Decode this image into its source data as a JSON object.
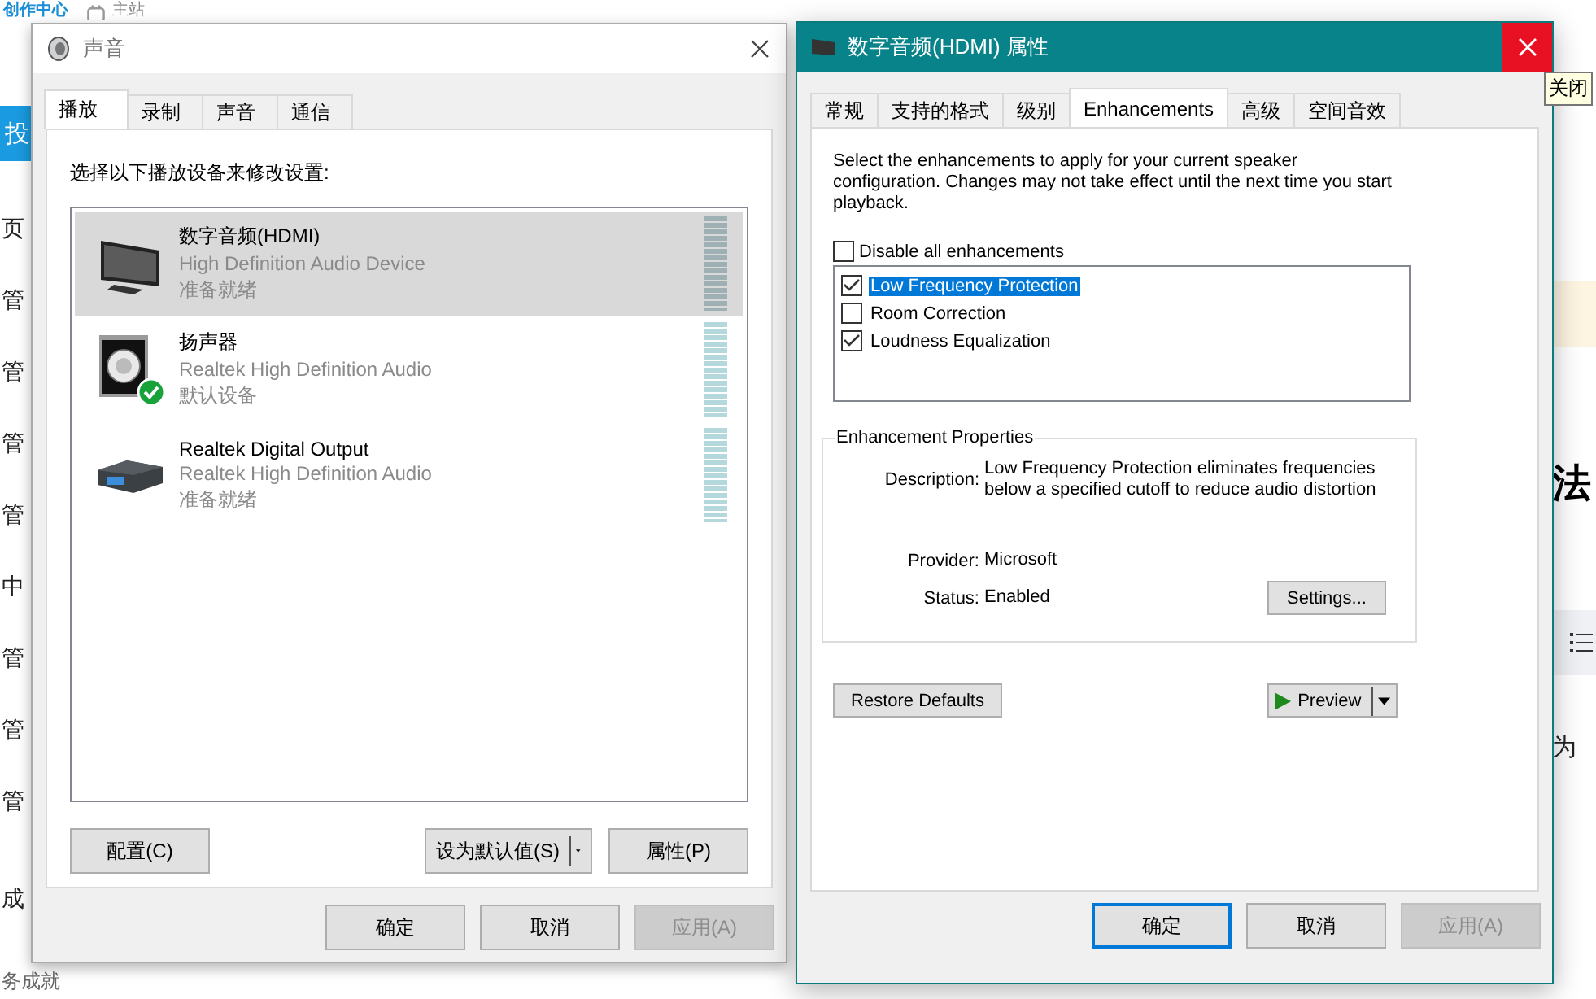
{
  "background_page": {
    "logo": "创作中心",
    "nav_link": "主站",
    "post_button": "投",
    "sidebar_items": [
      "页",
      "管",
      "管",
      "管",
      "管",
      "中",
      "管",
      "管",
      "管",
      "成"
    ],
    "footer_text": "务成就",
    "heading": "法",
    "snippet": "为"
  },
  "sound_dialog": {
    "title": "声音",
    "tabs": [
      {
        "label": "播放",
        "selected": true
      },
      {
        "label": "录制",
        "selected": false
      },
      {
        "label": "声音",
        "selected": false
      },
      {
        "label": "通信",
        "selected": false
      }
    ],
    "instruction": "选择以下播放设备来修改设置:",
    "devices": [
      {
        "kind": "monitor",
        "name": "数字音频(HDMI)",
        "driver": "High Definition Audio Device",
        "status": "准备就绪",
        "selected": true,
        "default": false
      },
      {
        "kind": "speaker",
        "name": "扬声器",
        "driver": "Realtek High Definition Audio",
        "status": "默认设备",
        "selected": false,
        "default": true
      },
      {
        "kind": "receiver",
        "name": "Realtek Digital Output",
        "driver": "Realtek High Definition Audio",
        "status": "准备就绪",
        "selected": false,
        "default": false
      }
    ],
    "configure_button": "配置(C)",
    "set_default_button": "设为默认值(S)",
    "properties_button": "属性(P)",
    "dialog_buttons": [
      {
        "label": "确定",
        "disabled": false
      },
      {
        "label": "取消",
        "disabled": false
      },
      {
        "label": "应用(A)",
        "disabled": true
      }
    ]
  },
  "properties_dialog": {
    "title": "数字音频(HDMI) 属性",
    "close_tooltip": "关闭",
    "tabs": [
      {
        "label": "常规",
        "selected": false
      },
      {
        "label": "支持的格式",
        "selected": false
      },
      {
        "label": "级别",
        "selected": false
      },
      {
        "label": "Enhancements",
        "selected": true
      },
      {
        "label": "高级",
        "selected": false
      },
      {
        "label": "空间音效",
        "selected": false
      }
    ],
    "intro": "Select the enhancements to apply for your current speaker configuration. Changes may not take effect until the next time you start playback.",
    "disable_all": {
      "label": "Disable all enhancements",
      "checked": false
    },
    "enhancements": [
      {
        "label": "Low Frequency Protection",
        "checked": true,
        "selected": true
      },
      {
        "label": "Room Correction",
        "checked": false,
        "selected": false
      },
      {
        "label": "Loudness Equalization",
        "checked": true,
        "selected": false
      }
    ],
    "group_title": "Enhancement Properties",
    "properties": [
      {
        "label": "Description:",
        "value": "Low Frequency Protection eliminates frequencies below a specified cutoff to reduce audio distortion"
      },
      {
        "label": "Provider:",
        "value": "Microsoft"
      },
      {
        "label": "Status:",
        "value": "Enabled"
      }
    ],
    "settings_button": "Settings...",
    "restore_button": "Restore Defaults",
    "preview_button": "Preview",
    "dialog_buttons": [
      {
        "label": "确定",
        "disabled": false,
        "focused": true
      },
      {
        "label": "取消",
        "disabled": false,
        "focused": false
      },
      {
        "label": "应用(A)",
        "disabled": true,
        "focused": false
      }
    ]
  }
}
